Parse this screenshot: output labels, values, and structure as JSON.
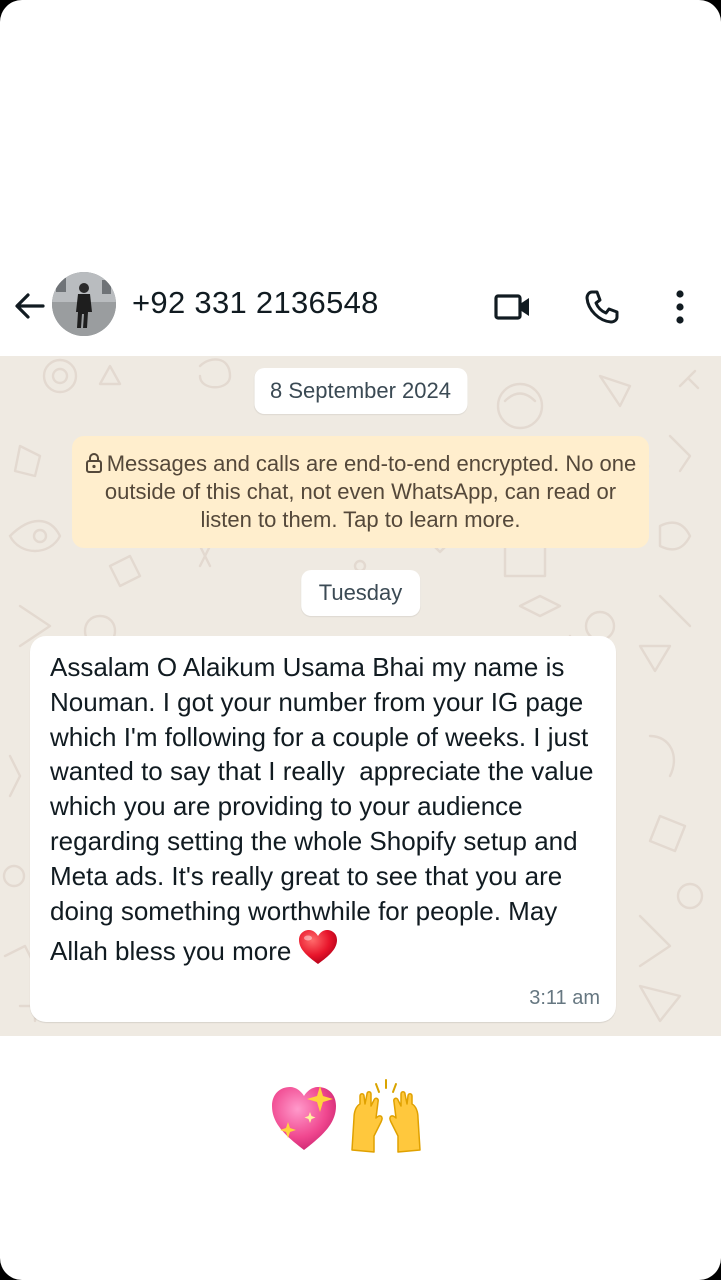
{
  "header": {
    "contact_name": "+92 331 2136548",
    "back_icon": "arrow-left-icon",
    "video_icon": "video-call-icon",
    "call_icon": "phone-icon",
    "menu_icon": "more-vertical-icon"
  },
  "chat": {
    "date_chip": "8 September 2024",
    "encryption_notice": "Messages and calls are end-to-end encrypted. No one outside of this chat, not even WhatsApp, can read or listen to them. Tap to learn more.",
    "day_chip": "Tuesday",
    "message": {
      "text": "Assalam O Alaikum Usama Bhai my name is Nouman. I got your number from your IG page which I'm following for a couple of weeks. I just wanted to say that I really  appreciate the value which you are providing to your audience regarding setting the whole Shopify setup and Meta ads. It's really great to see that you are doing something worthwhile for people. May Allah bless you more",
      "emoji": "red-heart-icon",
      "time": "3:11 am"
    }
  },
  "footer": {
    "emojis": [
      "sparkling-heart-icon",
      "raising-hands-icon"
    ]
  },
  "colors": {
    "chat_background": "#efeae2",
    "encryption_background": "#ffeecd",
    "bubble_background": "#ffffff",
    "text_primary": "#111b21",
    "text_secondary": "#667781"
  }
}
